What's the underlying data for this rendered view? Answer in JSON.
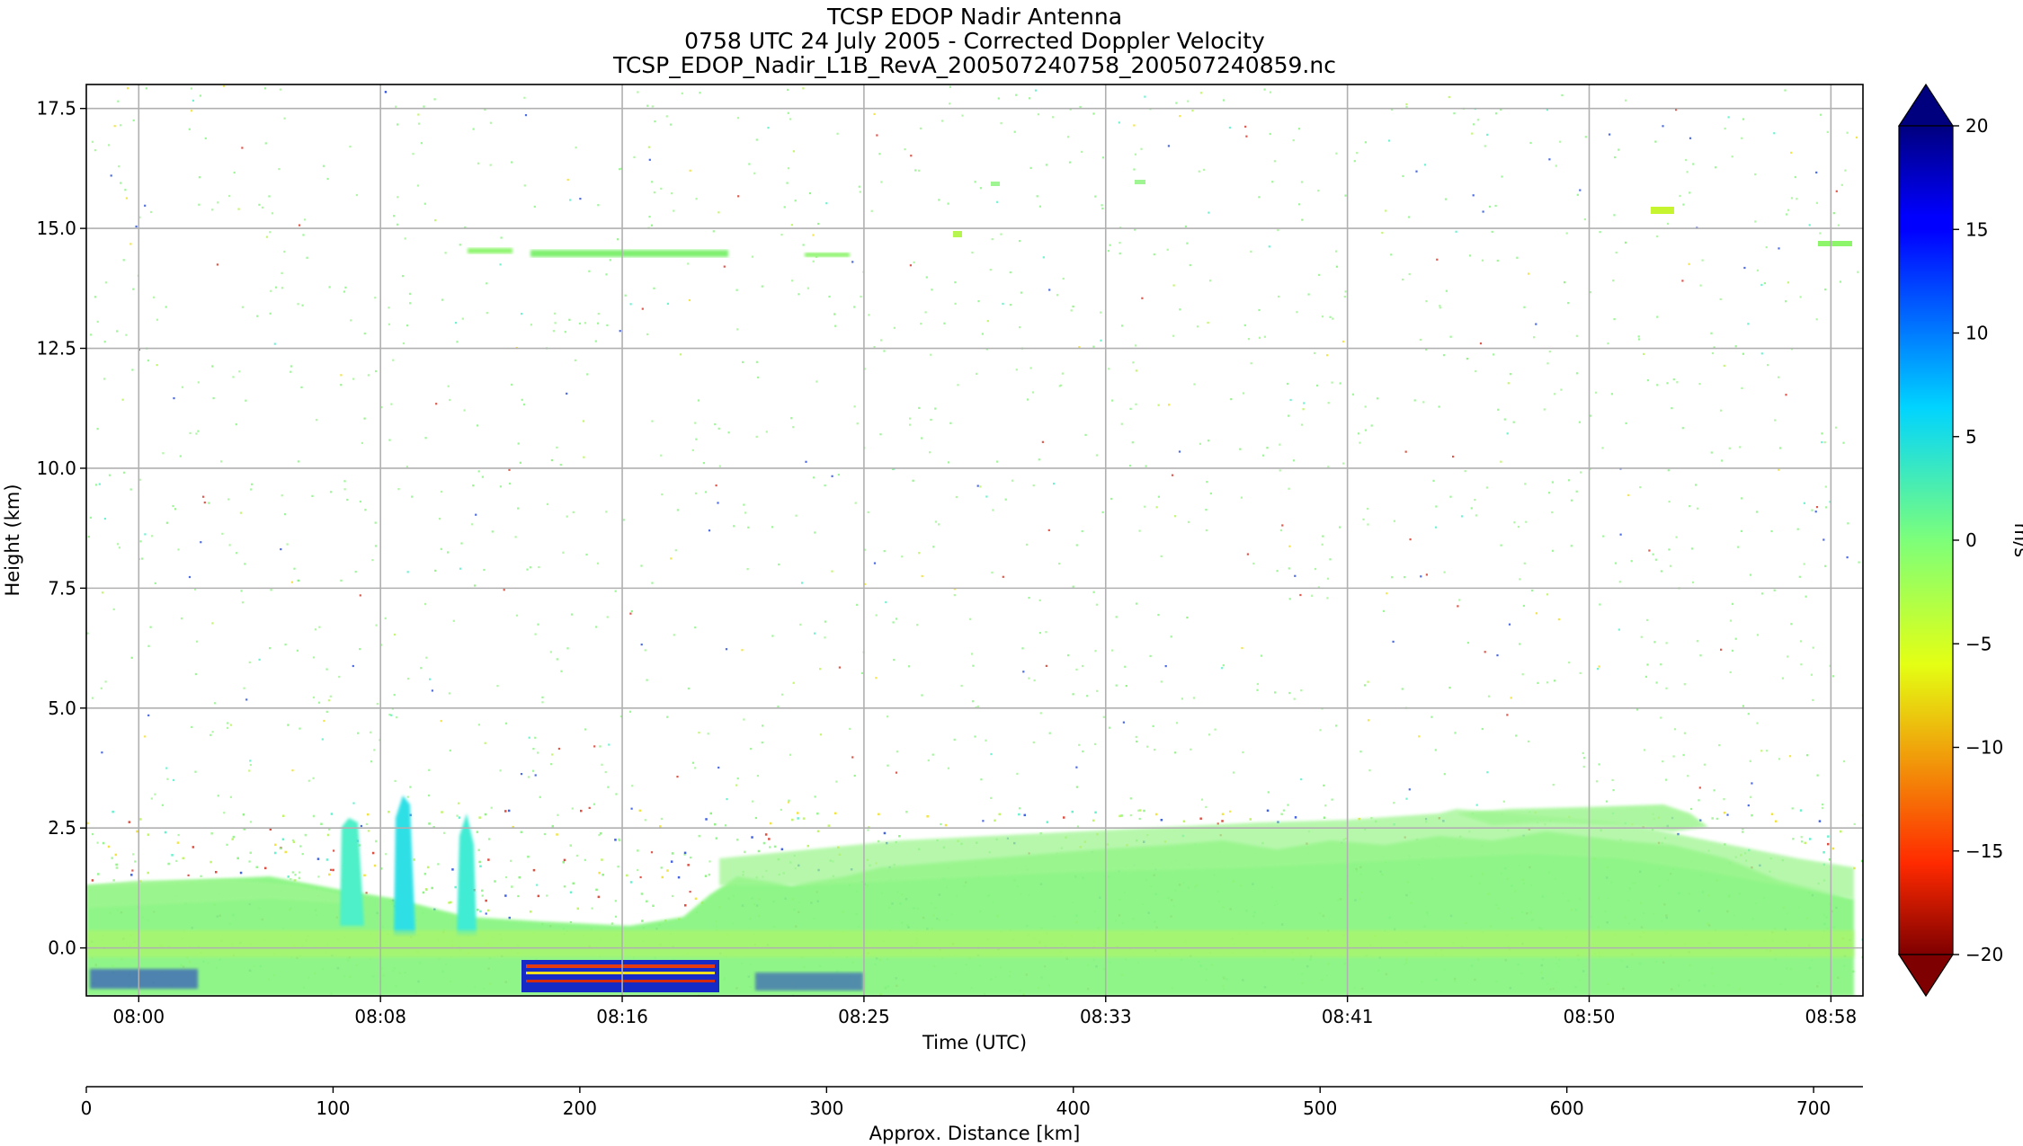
{
  "chart_data": {
    "type": "heatmap",
    "title": [
      "TCSP EDOP Nadir Antenna",
      "0758 UTC 24 July 2005 - Corrected Doppler Velocity",
      "TCSP_EDOP_Nadir_L1B_RevA_200507240758_200507240859.nc"
    ],
    "xlabel": "Time (UTC)",
    "ylabel": "Height (km)",
    "x2label": "Approx. Distance [km]",
    "colorbar_label": "m/s",
    "colormap": "jet_r",
    "xlim_minutes_after_0758": [
      0,
      61
    ],
    "ylim": [
      -1.0,
      18.0
    ],
    "x2lim": [
      0,
      720
    ],
    "grid": true,
    "x_ticks": [
      {
        "label": "08:00",
        "minutes": 1.8
      },
      {
        "label": "08:08",
        "minutes": 10.1
      },
      {
        "label": "08:16",
        "minutes": 18.4
      },
      {
        "label": "08:25",
        "minutes": 26.7
      },
      {
        "label": "08:33",
        "minutes": 35.0
      },
      {
        "label": "08:41",
        "minutes": 43.3
      },
      {
        "label": "08:50",
        "minutes": 51.6
      },
      {
        "label": "08:58",
        "minutes": 59.9
      }
    ],
    "y_ticks": [
      0.0,
      2.5,
      5.0,
      7.5,
      10.0,
      12.5,
      15.0,
      17.5
    ],
    "y_tick_labels": [
      "0.0",
      "2.5",
      "5.0",
      "7.5",
      "10.0",
      "12.5",
      "15.0",
      "17.5"
    ],
    "x2_ticks": [
      0,
      100,
      200,
      300,
      400,
      500,
      600,
      700
    ],
    "x2_tick_labels": [
      "0",
      "100",
      "200",
      "300",
      "400",
      "500",
      "600",
      "700"
    ],
    "colorbar_ticks": [
      20,
      15,
      10,
      5,
      0,
      -5,
      -10,
      -15,
      -20
    ],
    "colorbar_tick_labels": [
      "20",
      "15",
      "10",
      "5",
      "0",
      "−5",
      "−10",
      "−15",
      "−20"
    ],
    "colorbar_range": [
      -20,
      20
    ],
    "colorbar_extend": "both"
  }
}
